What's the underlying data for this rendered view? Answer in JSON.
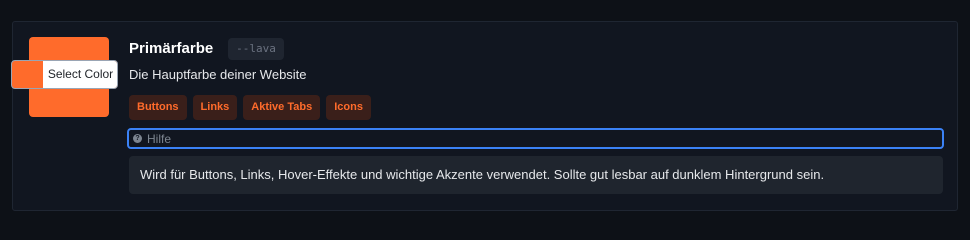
{
  "color_setting": {
    "title": "Primärfarbe",
    "variable": "--lava",
    "description": "Die Hauptfarbe deiner Website",
    "color": "#ff6b2b",
    "picker_label": "Select Color",
    "usage_tags": [
      "Buttons",
      "Links",
      "Aktive Tabs",
      "Icons"
    ],
    "help": {
      "icon": "question-icon",
      "summary": "Hilfe",
      "text": "Wird für Buttons, Links, Hover-Effekte und wichtige Akzente verwendet. Sollte gut lesbar auf dunklem Hintergrund sein."
    }
  }
}
